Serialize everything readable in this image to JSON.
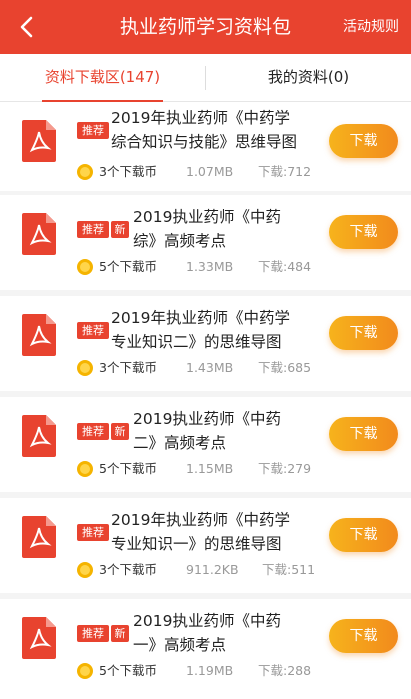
{
  "header": {
    "title": "执业药师学习资料包",
    "rules_label": "活动规则"
  },
  "tabs": {
    "left_label": "资料下载区(147)",
    "right_label": "我的资料(0)"
  },
  "items": [
    {
      "badge_rec": "推荐",
      "title_line1": "2019年执业药师《中药学",
      "title_line2": "综合知识与技能》思维导图",
      "coins": "3个下载币",
      "size": "1.07MB",
      "downloads": "下载:712",
      "button_label": "下载"
    },
    {
      "badge_rec": "推荐",
      "badge_new": "新",
      "title_line1": "2019执业药师《中药",
      "title_line2": "综》高频考点",
      "coins": "5个下载币",
      "size": "1.33MB",
      "downloads": "下载:484",
      "button_label": "下载"
    },
    {
      "badge_rec": "推荐",
      "title_line1": "2019年执业药师《中药学",
      "title_line2": "专业知识二》的思维导图",
      "coins": "3个下载币",
      "size": "1.43MB",
      "downloads": "下载:685",
      "button_label": "下载"
    },
    {
      "badge_rec": "推荐",
      "badge_new": "新",
      "title_line1": "2019执业药师《中药",
      "title_line2": "二》高频考点",
      "coins": "5个下载币",
      "size": "1.15MB",
      "downloads": "下载:279",
      "button_label": "下载"
    },
    {
      "badge_rec": "推荐",
      "title_line1": "2019年执业药师《中药学",
      "title_line2": "专业知识一》的思维导图",
      "coins": "3个下载币",
      "size": "911.2KB",
      "downloads": "下载:511",
      "button_label": "下载"
    },
    {
      "badge_rec": "推荐",
      "badge_new": "新",
      "title_line1": "2019执业药师《中药",
      "title_line2": "一》高频考点",
      "coins": "5个下载币",
      "size": "1.19MB",
      "downloads": "下载:288",
      "button_label": "下载"
    }
  ],
  "colors": {
    "accent": "#e8432f",
    "button_gradient_start": "#f6b31c",
    "button_gradient_end": "#f28a1c",
    "pdf_icon": "#e8432f",
    "coin": "#f5b400"
  },
  "icons": {
    "back": "chevron-left-icon",
    "file": "pdf-file-icon",
    "coin": "coin-icon"
  }
}
